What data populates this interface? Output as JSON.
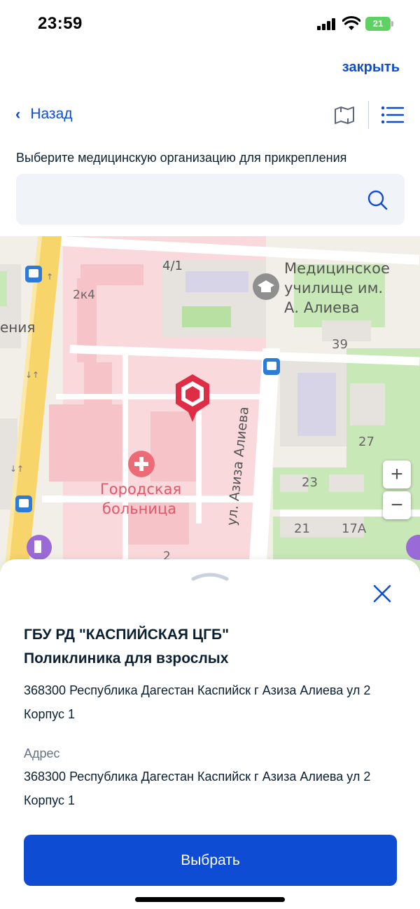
{
  "status_bar": {
    "time": "23:59",
    "battery": "21"
  },
  "header": {
    "close_label": "закрыть",
    "back_label": "Назад"
  },
  "prompt": "Выберите медицинскую организацию для прикрепления",
  "search": {
    "placeholder": "",
    "value": ""
  },
  "map": {
    "labels": {
      "building_4_1": "4/1",
      "building_2k4": "2к4",
      "school_line1": "Медицинское",
      "school_line2": "училище им.",
      "school_line3": "А. Алиева",
      "edge_fragment": "ения",
      "building_39": "39",
      "street": "ул. Азиза Алиева",
      "building_27": "27",
      "building_23": "23",
      "hospital_line1": "Городская",
      "hospital_line2": "больница",
      "building_21": "21",
      "building_17a": "17А",
      "building_2": "2"
    },
    "zoom_in": "+",
    "zoom_out": "−",
    "colors": {
      "hospital_area": "#f9d9dc",
      "hospital_building": "#f5c3c8",
      "road_main": "#f8d56a",
      "marker": "#e02d46",
      "green_area": "#c9e8b8"
    }
  },
  "sheet": {
    "org_name": "ГБУ РД \"КАСПИЙСКАЯ ЦГБ\"",
    "org_unit": "Поликлиника для взрослых",
    "org_address": "368300 Республика Дагестан Каспийск г Азиза Алиева ул 2 Корпус 1",
    "address_label": "Адрес",
    "address_value": "368300 Республика Дагестан Каспийск г Азиза Алиева ул 2 Корпус 1",
    "select_label": "Выбрать"
  },
  "colors": {
    "accent": "#0d4cd3",
    "text": "#0b1f33",
    "muted": "#66727f",
    "search_bg": "#f0f3f7"
  }
}
